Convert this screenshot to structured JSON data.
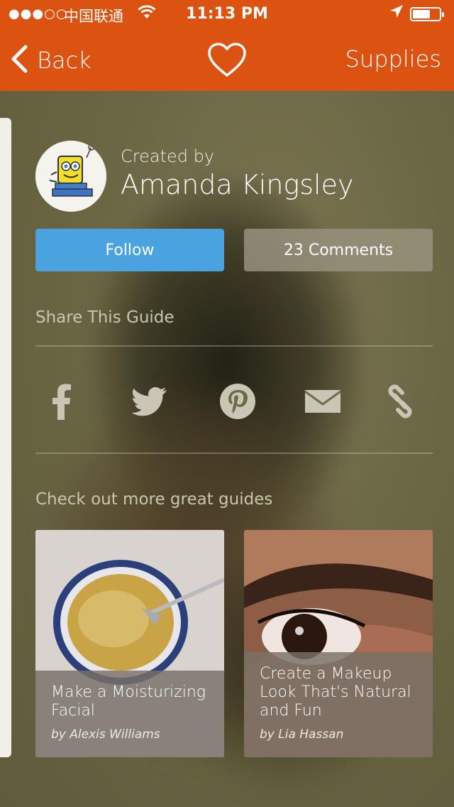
{
  "status_bar": {
    "carrier": "中国联通",
    "time": "11:13 PM"
  },
  "nav": {
    "back_label": "Back",
    "supplies_label": "Supplies"
  },
  "creator": {
    "created_by_label": "Created by",
    "name": "Amanda Kingsley"
  },
  "actions": {
    "follow_label": "Follow",
    "comments_label": "23 Comments"
  },
  "share": {
    "title": "Share This Guide",
    "icons": [
      "facebook-icon",
      "twitter-icon",
      "pinterest-icon",
      "mail-icon",
      "link-icon"
    ]
  },
  "more": {
    "title": "Check out more great guides",
    "cards": [
      {
        "title": "Make a Moisturizing Facial",
        "byline": "by Alexis Williams"
      },
      {
        "title": "Create a Makeup Look That's Natural and Fun",
        "byline": "by Lia Hassan"
      }
    ]
  },
  "colors": {
    "nav_bar": "#dc5311",
    "follow_button": "#49a3df"
  }
}
